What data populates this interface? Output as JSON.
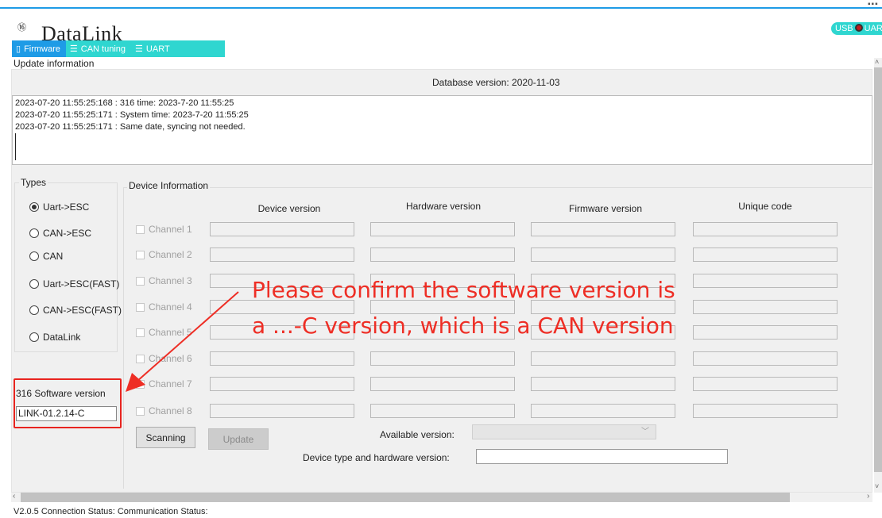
{
  "app": {
    "logo_mark": "⑯",
    "title": "DataLink",
    "usb_badge": "USB",
    "usb_badge_suffix": "UAR",
    "top_dots": "▪▪▪"
  },
  "tabs": [
    {
      "icon": "chip-icon",
      "glyph": "▯",
      "label": "Firmware"
    },
    {
      "icon": "list-icon",
      "glyph": "☰",
      "label": "CAN tuning"
    },
    {
      "icon": "list-icon",
      "glyph": "☰",
      "label": "UART"
    }
  ],
  "update": {
    "section_label": "Update information",
    "database_version": "Database version: 2020-11-03",
    "log_lines": [
      "2023-07-20 11:55:25:168 : 316  time: 2023-7-20 11:55:25",
      "2023-07-20 11:55:25:171 : System time: 2023-7-20 11:55:25",
      "2023-07-20 11:55:25:171 : Same date, syncing not needed."
    ]
  },
  "types": {
    "legend": "Types",
    "options": [
      {
        "label": "Uart->ESC",
        "selected": true
      },
      {
        "label": "CAN->ESC",
        "selected": false
      },
      {
        "label": "CAN",
        "selected": false
      },
      {
        "label": "Uart->ESC(FAST)",
        "selected": false
      },
      {
        "label": "CAN->ESC(FAST)",
        "selected": false
      },
      {
        "label": "DataLink",
        "selected": false
      }
    ]
  },
  "software": {
    "label": "316 Software version",
    "value": "LINK-01.2.14-C"
  },
  "device_info": {
    "legend": "Device Information",
    "columns": [
      "Device version",
      "Hardware version",
      "Firmware version",
      "Unique code"
    ],
    "channels": [
      "Channel 1",
      "Channel 2",
      "Channel 3",
      "Channel 4",
      "Channel 5",
      "Channel 6",
      "Channel 7",
      "Channel 8"
    ]
  },
  "actions": {
    "scan_label": "Scanning",
    "update_label": "Update",
    "available_version_label": "Available version:",
    "select_arrow": "﹀",
    "device_type_label": "Device type and hardware version:"
  },
  "annotation": {
    "line1": "Please confirm the software version is",
    "line2": "a ...-C version, which is a CAN version",
    "color": "#ee2e25"
  },
  "scroll": {
    "left_arrow": "‹",
    "right_arrow": "›",
    "up_arrow": "˄",
    "down_arrow": "˅"
  },
  "status_bar": {
    "text": "V2.0.5 Connection Status:    Communication Status:"
  }
}
